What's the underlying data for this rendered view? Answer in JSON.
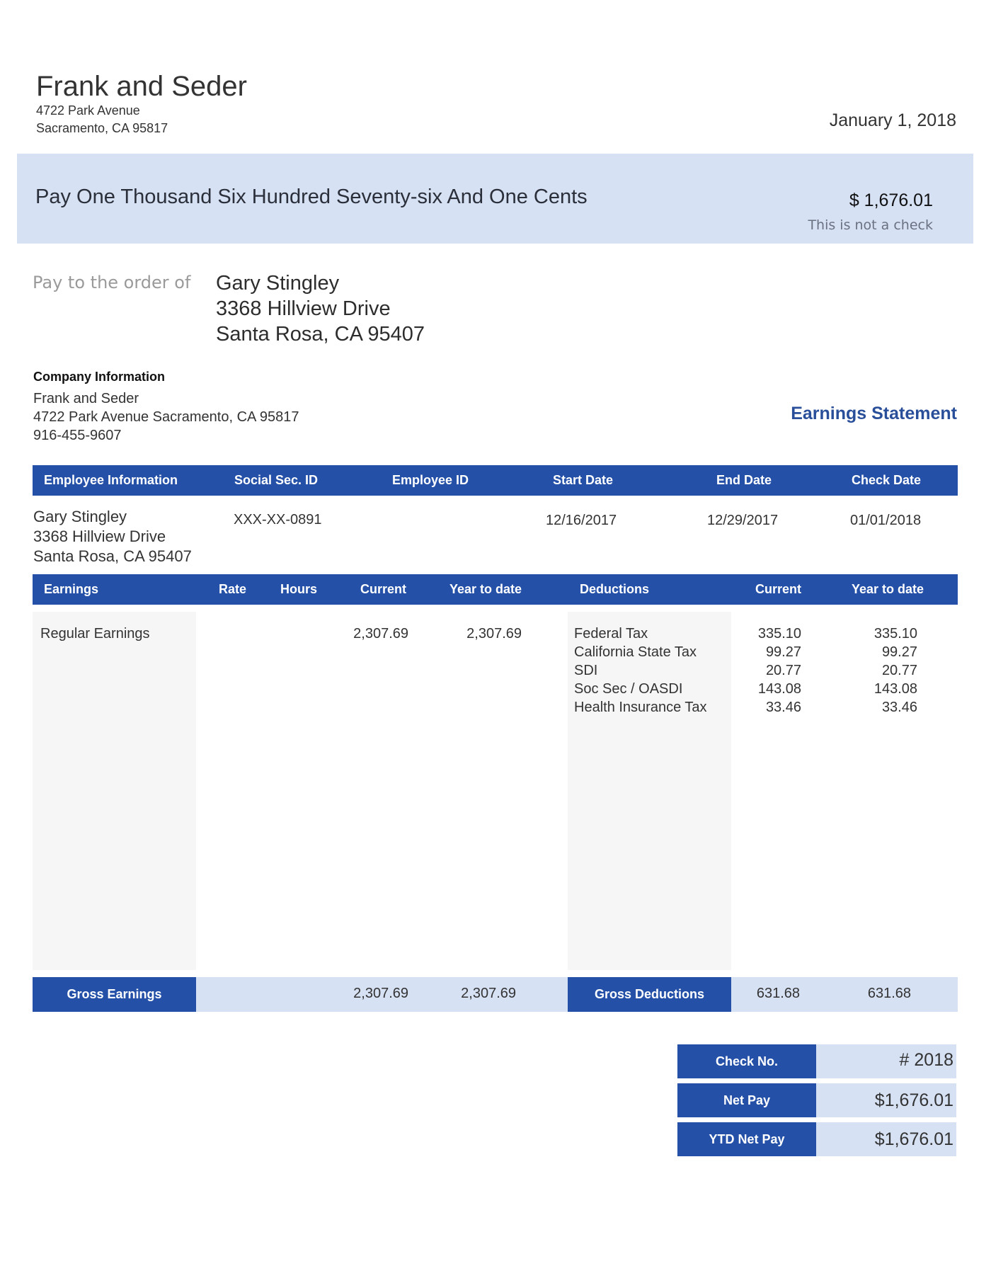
{
  "company": {
    "name": "Frank and Seder",
    "address_line1": "4722 Park Avenue",
    "address_line2": "Sacramento, CA 95817"
  },
  "date": "January 1, 2018",
  "check_band": {
    "amount_words": "Pay One Thousand Six Hundred Seventy-six And One Cents",
    "amount": "$ 1,676.01",
    "disclaimer": "This is not a check"
  },
  "payee": {
    "label": "Pay to the order of",
    "name": "Gary Stingley",
    "address_line1": "3368 Hillview Drive",
    "address_line2": "Santa Rosa, CA 95407"
  },
  "company_info": {
    "heading": "Company Information",
    "name": "Frank and Seder",
    "address": "4722 Park Avenue Sacramento, CA 95817",
    "phone": "916-455-9607"
  },
  "statement_title": "Earnings Statement",
  "employee_table": {
    "headers": [
      "Employee Information",
      "Social Sec. ID",
      "Employee ID",
      "Start Date",
      "End Date",
      "Check Date"
    ],
    "employee_name": "Gary Stingley",
    "employee_address1": "3368 Hillview Drive",
    "employee_address2": "Santa Rosa, CA 95407",
    "ssn": "XXX-XX-0891",
    "employee_id": "",
    "start_date": "12/16/2017",
    "end_date": "12/29/2017",
    "check_date": "01/01/2018"
  },
  "earnings": {
    "headers": [
      "Earnings",
      "Rate",
      "Hours",
      "Current",
      "Year to date"
    ],
    "rows": [
      {
        "name": "Regular Earnings",
        "rate": "",
        "hours": "",
        "current": "2,307.69",
        "ytd": "2,307.69"
      }
    ],
    "gross_label": "Gross Earnings",
    "gross_current": "2,307.69",
    "gross_ytd": "2,307.69"
  },
  "deductions": {
    "headers": [
      "Deductions",
      "Current",
      "Year to date"
    ],
    "rows": [
      {
        "name": "Federal Tax",
        "current": "335.10",
        "ytd": "335.10"
      },
      {
        "name": "California State Tax",
        "current": "99.27",
        "ytd": "99.27"
      },
      {
        "name": "SDI",
        "current": "20.77",
        "ytd": "20.77"
      },
      {
        "name": "Soc Sec / OASDI",
        "current": "143.08",
        "ytd": "143.08"
      },
      {
        "name": "Health Insurance Tax",
        "current": "33.46",
        "ytd": "33.46"
      }
    ],
    "gross_label": "Gross Deductions",
    "gross_current": "631.68",
    "gross_ytd": "631.68"
  },
  "summary": {
    "check_no_label": "Check No.",
    "check_no": "# 2018",
    "net_pay_label": "Net Pay",
    "net_pay": "$1,676.01",
    "ytd_net_pay_label": "YTD Net Pay",
    "ytd_net_pay": "$1,676.01"
  },
  "colors": {
    "header_blue": "#2450a8",
    "band_light_blue": "#d6e1f4",
    "title_blue": "#2a4f9a",
    "column_grey": "#f6f6f7"
  }
}
